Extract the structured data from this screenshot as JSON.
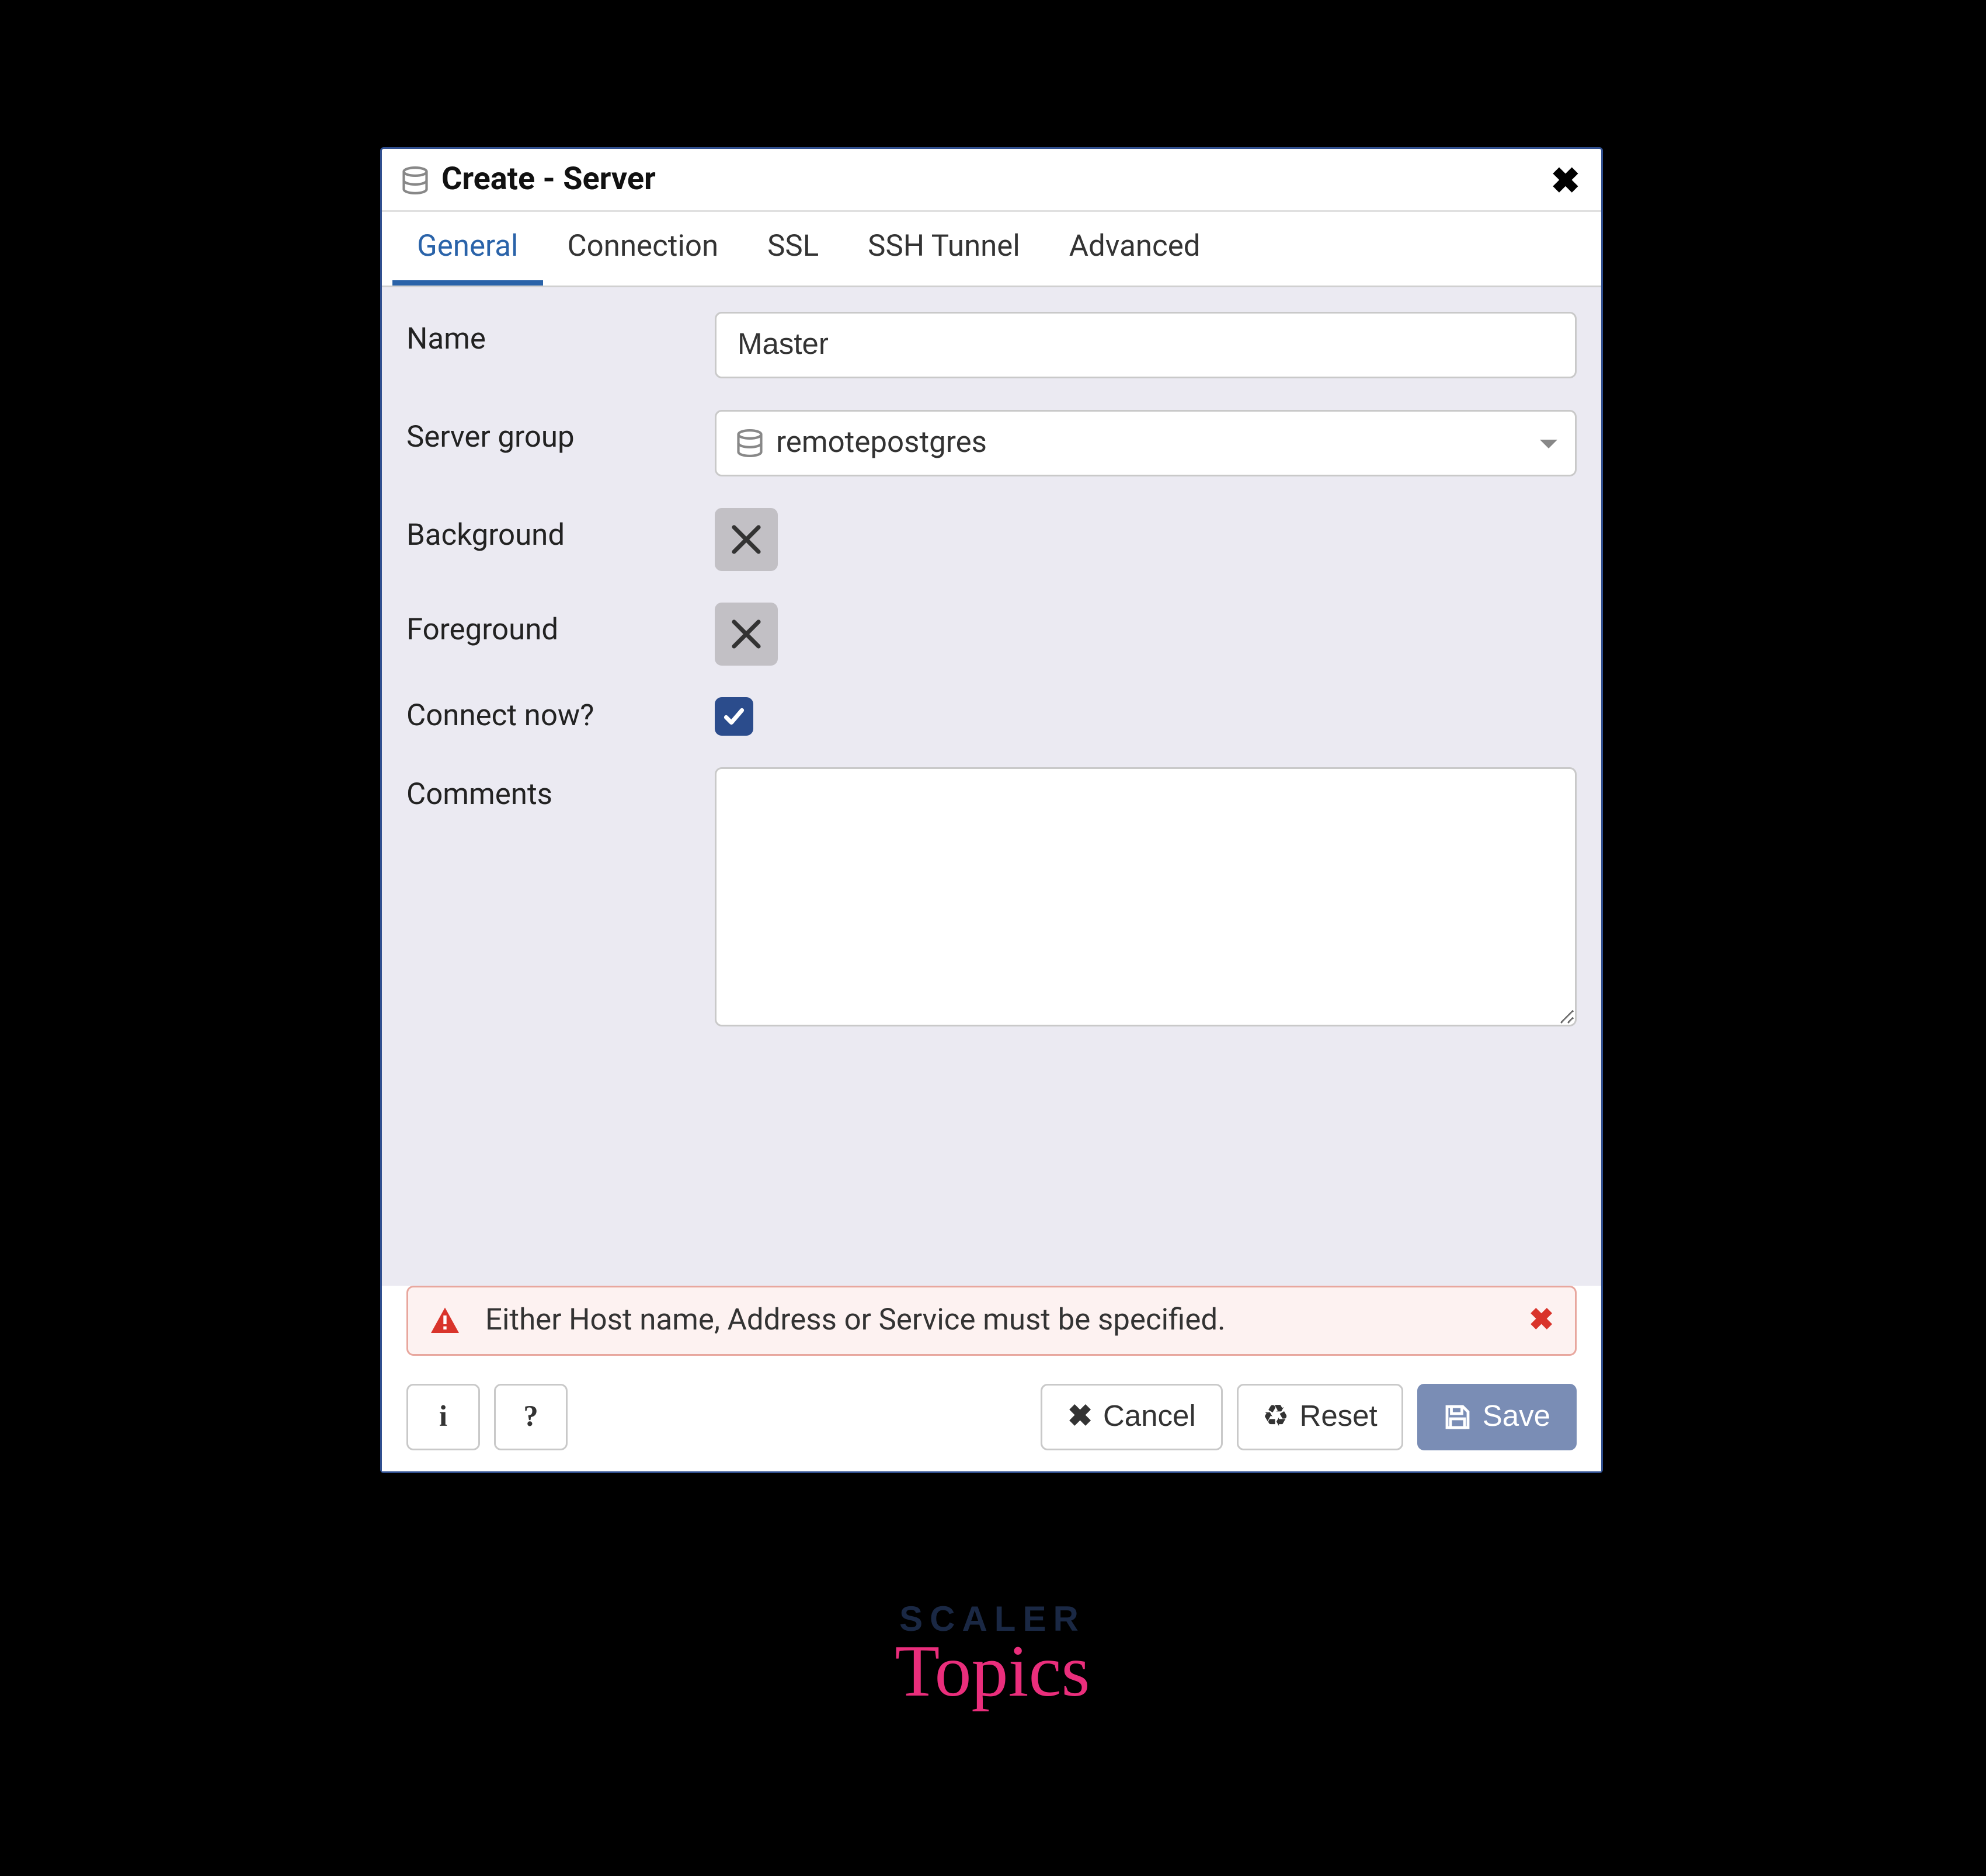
{
  "dialog": {
    "title": "Create - Server",
    "tabs": [
      "General",
      "Connection",
      "SSL",
      "SSH Tunnel",
      "Advanced"
    ],
    "active_tab_index": 0
  },
  "form": {
    "name_label": "Name",
    "name_value": "Master",
    "server_group_label": "Server group",
    "server_group_value": "remotepostgres",
    "background_label": "Background",
    "foreground_label": "Foreground",
    "connect_now_label": "Connect now?",
    "connect_now_checked": true,
    "comments_label": "Comments",
    "comments_value": ""
  },
  "error": {
    "message": "Either Host name, Address or Service must be specified."
  },
  "footer": {
    "info_label": "i",
    "help_label": "?",
    "cancel_label": "Cancel",
    "reset_label": "Reset",
    "save_label": "Save"
  },
  "watermark": {
    "line1": "SCALER",
    "line2": "Topics"
  }
}
